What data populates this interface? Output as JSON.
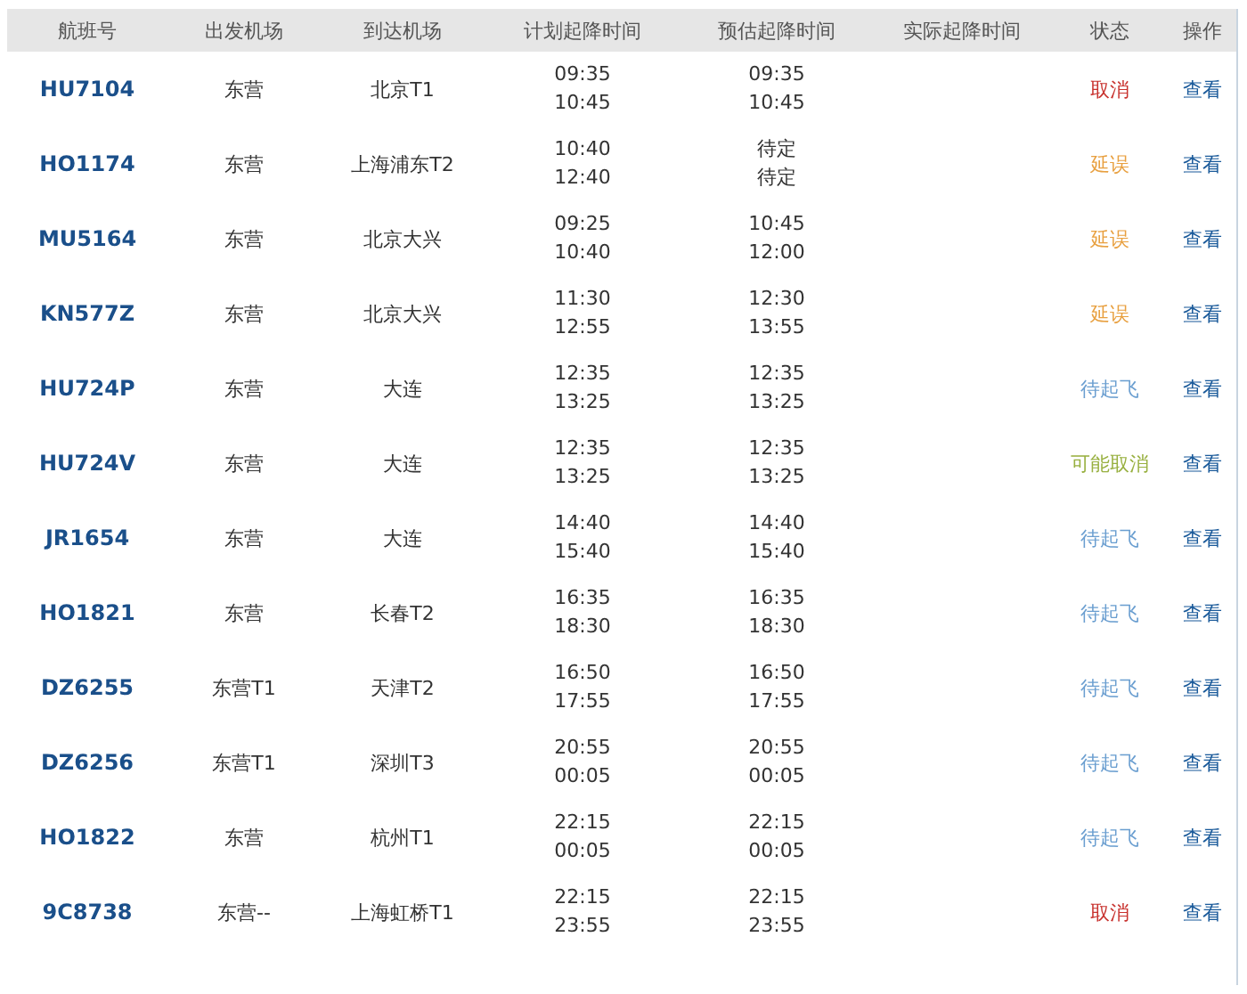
{
  "columns": [
    "航班号",
    "出发机场",
    "到达机场",
    "计划起降时间",
    "预估起降时间",
    "实际起降时间",
    "状态",
    "操作"
  ],
  "flights": [
    {
      "flight": "HU7104",
      "from": "东营",
      "to": "北京T1",
      "planned": [
        "09:35",
        "10:45"
      ],
      "estimated": [
        "09:35",
        "10:45"
      ],
      "status": "取消",
      "color": "#c8322e",
      "action": "查看"
    },
    {
      "flight": "HO1174",
      "from": "东营",
      "to": "上海浦东T2",
      "planned": [
        "10:40",
        "12:40"
      ],
      "estimated": [
        "待定",
        "待定"
      ],
      "status": "延误",
      "color": "#e8a040",
      "action": "查看"
    },
    {
      "flight": "MU5164",
      "from": "东营",
      "to": "北京大兴",
      "planned": [
        "09:25",
        "10:40"
      ],
      "estimated": [
        "10:45",
        "12:00"
      ],
      "status": "延误",
      "color": "#e8a040",
      "action": "查看"
    },
    {
      "flight": "KN577Z",
      "from": "东营",
      "to": "北京大兴",
      "planned": [
        "11:30",
        "12:55"
      ],
      "estimated": [
        "12:30",
        "13:55"
      ],
      "status": "延误",
      "color": "#e8a040",
      "action": "查看"
    },
    {
      "flight": "HU724P",
      "from": "东营",
      "to": "大连",
      "planned": [
        "12:35",
        "13:25"
      ],
      "estimated": [
        "12:35",
        "13:25"
      ],
      "status": "待起飞",
      "color": "#6a9ed0",
      "action": "查看"
    },
    {
      "flight": "HU724V",
      "from": "东营",
      "to": "大连",
      "planned": [
        "12:35",
        "13:25"
      ],
      "estimated": [
        "12:35",
        "13:25"
      ],
      "status": "可能取消",
      "color": "#98b040",
      "action": "查看"
    },
    {
      "flight": "JR1654",
      "from": "东营",
      "to": "大连",
      "planned": [
        "14:40",
        "15:40"
      ],
      "estimated": [
        "14:40",
        "15:40"
      ],
      "status": "待起飞",
      "color": "#6a9ed0",
      "action": "查看"
    },
    {
      "flight": "HO1821",
      "from": "东营",
      "to": "长春T2",
      "planned": [
        "16:35",
        "18:30"
      ],
      "estimated": [
        "16:35",
        "18:30"
      ],
      "status": "待起飞",
      "color": "#6a9ed0",
      "action": "查看"
    },
    {
      "flight": "DZ6255",
      "from": "东营T1",
      "to": "天津T2",
      "planned": [
        "16:50",
        "17:55"
      ],
      "estimated": [
        "16:50",
        "17:55"
      ],
      "status": "待起飞",
      "color": "#6a9ed0",
      "action": "查看"
    },
    {
      "flight": "DZ6256",
      "from": "东营T1",
      "to": "深圳T3",
      "planned": [
        "20:55",
        "00:05"
      ],
      "estimated": [
        "20:55",
        "00:05"
      ],
      "status": "待起飞",
      "color": "#6a9ed0",
      "action": "查看"
    },
    {
      "flight": "HO1822",
      "from": "东营",
      "to": "杭州T1",
      "planned": [
        "22:15",
        "00:05"
      ],
      "estimated": [
        "22:15",
        "00:05"
      ],
      "status": "待起飞",
      "color": "#6a9ed0",
      "action": "查看"
    },
    {
      "flight": "9C8738",
      "from": "东营--",
      "to": "上海虹桥T1",
      "planned": [
        "22:15",
        "23:55"
      ],
      "estimated": [
        "22:15",
        "23:55"
      ],
      "status": "取消",
      "color": "#c8322e",
      "action": "查看"
    }
  ]
}
